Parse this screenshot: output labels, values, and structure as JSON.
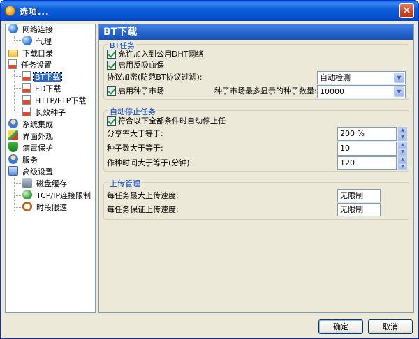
{
  "window": {
    "title": "选项..."
  },
  "tree": {
    "items": [
      {
        "label": "网络连接",
        "icon": "globe-icon"
      },
      {
        "label": "代理",
        "icon": "globe-icon"
      },
      {
        "label": "下载目录",
        "icon": "folder-icon"
      },
      {
        "label": "任务设置",
        "icon": "document-icon"
      },
      {
        "label": "BT下载",
        "icon": "document-icon"
      },
      {
        "label": "ED下载",
        "icon": "document-icon"
      },
      {
        "label": "HTTP/FTP下载",
        "icon": "document-icon"
      },
      {
        "label": "长效种子",
        "icon": "document-icon"
      },
      {
        "label": "系统集成",
        "icon": "people-icon"
      },
      {
        "label": "界面外观",
        "icon": "paint-icon"
      },
      {
        "label": "病毒保护",
        "icon": "shield-icon"
      },
      {
        "label": "服务",
        "icon": "people-icon"
      },
      {
        "label": "高级设置",
        "icon": "settings-icon"
      },
      {
        "label": "磁盘缓存",
        "icon": "disk-icon"
      },
      {
        "label": "TCP/IP连接限制",
        "icon": "network-icon"
      },
      {
        "label": "时段限速",
        "icon": "clock-icon"
      }
    ],
    "selected": "BT下载"
  },
  "panel": {
    "title": "BT下载",
    "bt_task": {
      "title": "BT任务",
      "allow_dht": {
        "label": "允许加入到公用DHT网络",
        "checked": true
      },
      "anti_leech": {
        "label": "启用反吸血保",
        "checked": true
      },
      "protocol_label": "协议加密(防范BT协议过滤):",
      "protocol_value": "自动检测",
      "seed_market": {
        "label": "启用种子市场",
        "checked": true
      },
      "seed_max_label": "种子市场最多显示的种子数量:",
      "seed_max_value": "10000"
    },
    "auto_stop": {
      "title": "自动停止任务",
      "all_conditions": {
        "label": "符合以下全部条件时自动停止任",
        "checked": true
      },
      "share_ratio_label": "分享率大于等于:",
      "share_ratio_value": "200 %",
      "seed_count_label": "种子数大于等于:",
      "seed_count_value": "10",
      "work_time_label": "作种时间大于等于(分钟):",
      "work_time_value": "120"
    },
    "upload": {
      "title": "上传管理",
      "max_speed_label": "每任务最大上传速度:",
      "max_speed_value": "无限制",
      "guaranteed_speed_label": "每任务保证上传速度:",
      "guaranteed_speed_value": "无限制"
    }
  },
  "buttons": {
    "ok": "确定",
    "cancel": "取消"
  }
}
